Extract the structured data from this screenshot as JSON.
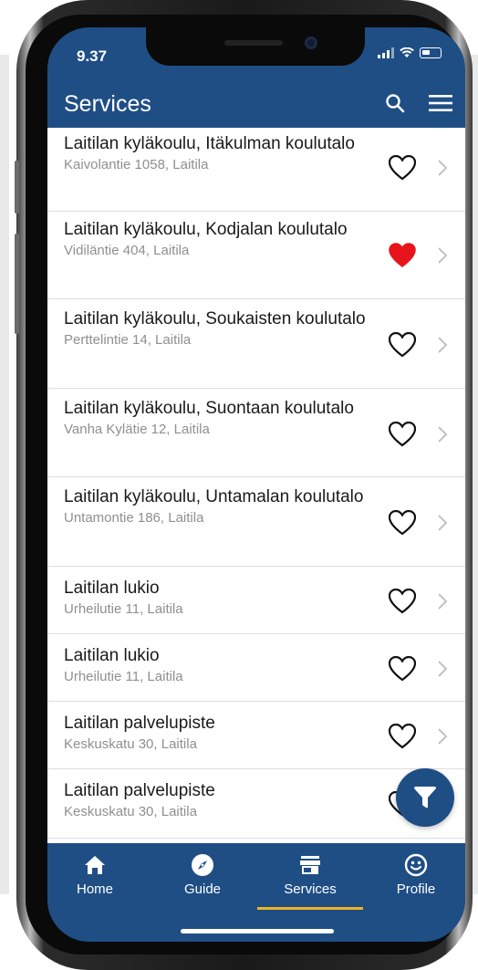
{
  "status_bar": {
    "time": "9.37"
  },
  "header": {
    "title": "Services",
    "search_icon": "search-icon",
    "menu_icon": "menu-icon"
  },
  "list": {
    "items": [
      {
        "title": "Laitilan kyläkoulu, Itäkulman koulutalo",
        "address": "Kaivolantie 1058,  Laitila",
        "favorite": false
      },
      {
        "title": "Laitilan kyläkoulu, Kodjalan koulutalo",
        "address": "Vidiläntie 404,  Laitila",
        "favorite": true
      },
      {
        "title": "Laitilan kyläkoulu, Soukaisten koulutalo",
        "address": "Perttelintie 14,  Laitila",
        "favorite": false
      },
      {
        "title": "Laitilan kyläkoulu, Suontaan koulutalo",
        "address": "Vanha Kylätie 12,  Laitila",
        "favorite": false
      },
      {
        "title": "Laitilan kyläkoulu, Untamalan koulutalo",
        "address": "Untamontie 186,  Laitila",
        "favorite": false
      },
      {
        "title": "Laitilan lukio",
        "address": "Urheilutie 11,  Laitila",
        "favorite": false
      },
      {
        "title": "Laitilan lukio",
        "address": "Urheilutie 11,  Laitila",
        "favorite": false
      },
      {
        "title": "Laitilan palvelupiste",
        "address": "Keskuskatu 30,  Laitila",
        "favorite": false
      },
      {
        "title": "Laitilan palvelupiste",
        "address": "Keskuskatu 30,  Laitila",
        "favorite": false
      }
    ]
  },
  "fab": {
    "icon": "filter-icon"
  },
  "tabbar": {
    "tabs": [
      {
        "label": "Home",
        "icon": "home-icon"
      },
      {
        "label": "Guide",
        "icon": "compass-icon"
      },
      {
        "label": "Services",
        "icon": "store-icon",
        "active": true
      },
      {
        "label": "Profile",
        "icon": "smiley-icon"
      }
    ]
  },
  "colors": {
    "brand": "#1f4e85",
    "accent": "#f0b323",
    "favorite": "#e8141b"
  }
}
